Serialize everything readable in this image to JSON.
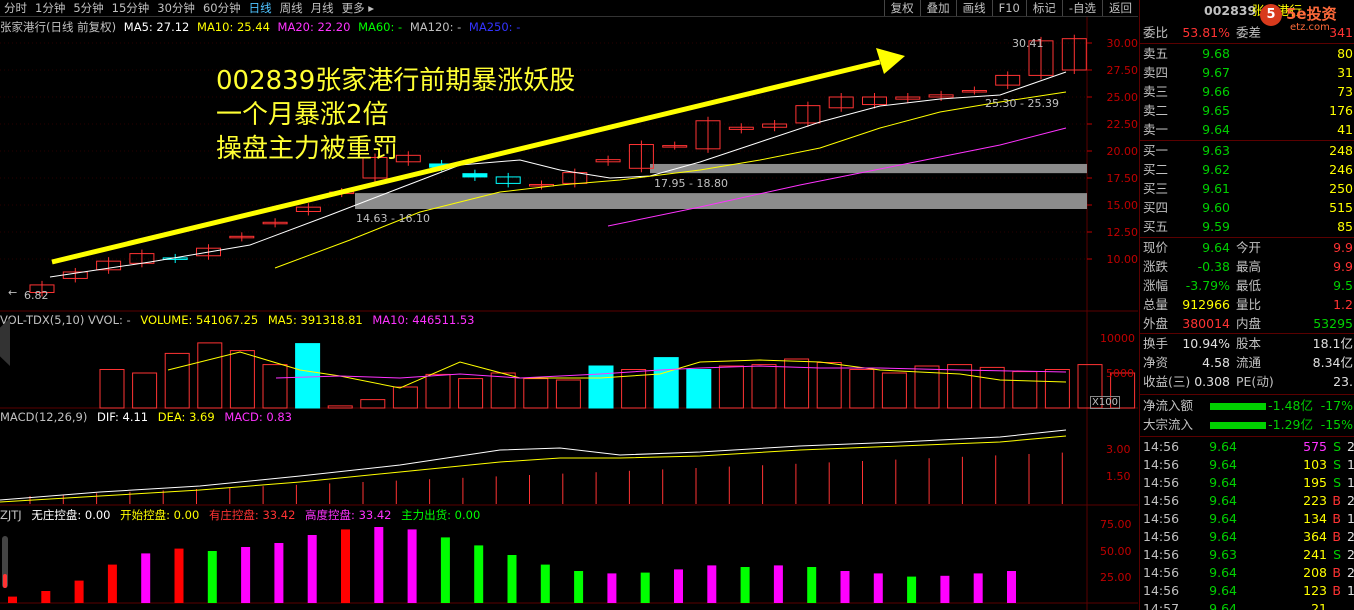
{
  "toolbar": {
    "periods": [
      "分时",
      "1分钟",
      "5分钟",
      "15分钟",
      "30分钟",
      "60分钟",
      "日线",
      "周线",
      "月线",
      "更多 ▸"
    ],
    "active_index": 6,
    "tools": [
      "复权",
      "叠加",
      "画线",
      "F10",
      "标记",
      "-自选",
      "返回"
    ]
  },
  "main_chart": {
    "title": "张家港行(日线 前复权)",
    "ma_labels": [
      {
        "text": "MA5: 27.12",
        "color": "#ffffff"
      },
      {
        "text": "MA10: 25.44",
        "color": "#ffff00"
      },
      {
        "text": "MA20: 22.20",
        "color": "#ff33ff"
      },
      {
        "text": "MA60: -",
        "color": "#00ff00"
      },
      {
        "text": "MA120: -",
        "color": "#c0c0c0"
      },
      {
        "text": "MA250: -",
        "color": "#3333ff"
      }
    ],
    "y_ticks": [
      "30.00",
      "27.50",
      "25.00",
      "22.50",
      "20.00",
      "17.50",
      "15.00",
      "12.50",
      "10.00"
    ],
    "labels": {
      "high": "30.41",
      "low": "6.82",
      "gap1": "14.63 - 16.10",
      "gap2": "17.95 - 18.80",
      "gap3": "25.30 - 25.39"
    },
    "annotation": [
      "002839张家港行前期暴涨妖股",
      "一个月暴涨2倍",
      "操盘主力被重罚"
    ]
  },
  "volume_panel": {
    "title": "VOL-TDX(5,10) VVOL: -",
    "values": [
      {
        "text": "VOLUME: 541067.25",
        "color": "#ffff00"
      },
      {
        "text": "MA5: 391318.81",
        "color": "#ffff00"
      },
      {
        "text": "MA10: 446511.53",
        "color": "#ff33ff"
      }
    ],
    "y_ticks": [
      "10000",
      "5000"
    ],
    "unit": "X100"
  },
  "macd_panel": {
    "title": "MACD(12,26,9)",
    "values": [
      {
        "text": "DIF: 4.11",
        "color": "#ffffff"
      },
      {
        "text": "DEA: 3.69",
        "color": "#ffff00"
      },
      {
        "text": "MACD: 0.83",
        "color": "#ff33ff"
      }
    ],
    "y_ticks": [
      "3.00",
      "1.50"
    ]
  },
  "zjtj_panel": {
    "title": "ZJTJ",
    "values": [
      {
        "text": "无庄控盘: 0.00",
        "color": "#ffffff"
      },
      {
        "text": "开始控盘: 0.00",
        "color": "#ffff00"
      },
      {
        "text": "有庄控盘: 33.42",
        "color": "#ff3333"
      },
      {
        "text": "高度控盘: 33.42",
        "color": "#ff33ff"
      },
      {
        "text": "主力出货: 0.00",
        "color": "#00ff00"
      }
    ],
    "y_ticks": [
      "75.00",
      "50.00",
      "25.00"
    ]
  },
  "quote": {
    "code": "002839",
    "name_partial": "张家港行",
    "webi_ratio_label": "委比",
    "webi_ratio": "53.81%",
    "webi_diff_label": "委差",
    "webi_diff": "341",
    "sells": [
      {
        "label": "卖五",
        "price": "9.68",
        "vol": "80"
      },
      {
        "label": "卖四",
        "price": "9.67",
        "vol": "31"
      },
      {
        "label": "卖三",
        "price": "9.66",
        "vol": "73"
      },
      {
        "label": "卖二",
        "price": "9.65",
        "vol": "176"
      },
      {
        "label": "卖一",
        "price": "9.64",
        "vol": "41"
      }
    ],
    "buys": [
      {
        "label": "买一",
        "price": "9.63",
        "vol": "248"
      },
      {
        "label": "买二",
        "price": "9.62",
        "vol": "246"
      },
      {
        "label": "买三",
        "price": "9.61",
        "vol": "250"
      },
      {
        "label": "买四",
        "price": "9.60",
        "vol": "515"
      },
      {
        "label": "买五",
        "price": "9.59",
        "vol": "85"
      }
    ],
    "stats": [
      {
        "l1": "现价",
        "v1": "9.64",
        "c1": "#00d000",
        "l2": "今开",
        "v2": "9.9",
        "c2": "#ff3333"
      },
      {
        "l1": "涨跌",
        "v1": "-0.38",
        "c1": "#00d000",
        "l2": "最高",
        "v2": "9.9",
        "c2": "#ff3333"
      },
      {
        "l1": "涨幅",
        "v1": "-3.79%",
        "c1": "#00d000",
        "l2": "最低",
        "v2": "9.5",
        "c2": "#00d000"
      },
      {
        "l1": "总量",
        "v1": "912966",
        "c1": "#ffff00",
        "l2": "量比",
        "v2": "1.2",
        "c2": "#ff3333"
      },
      {
        "l1": "外盘",
        "v1": "380014",
        "c1": "#ff3333",
        "l2": "内盘",
        "v2": "53295",
        "c2": "#00d000"
      }
    ],
    "fundamentals": [
      {
        "l1": "换手",
        "v1": "10.94%",
        "l2": "股本",
        "v2": "18.1亿"
      },
      {
        "l1": "净资",
        "v1": "4.58",
        "l2": "流通",
        "v2": "8.34亿"
      },
      {
        "l1": "收益(三)",
        "v1": "0.308",
        "l2": "PE(动)",
        "v2": "23."
      }
    ],
    "flows": [
      {
        "label": "净流入额",
        "value": "-1.48亿",
        "pct": "-17%"
      },
      {
        "label": "大宗流入",
        "value": "-1.29亿",
        "pct": "-15%"
      }
    ],
    "ticks": [
      {
        "time": "14:56",
        "price": "9.64",
        "vol": "575",
        "side": "S",
        "n": "2"
      },
      {
        "time": "14:56",
        "price": "9.64",
        "vol": "103",
        "side": "S",
        "n": "1"
      },
      {
        "time": "14:56",
        "price": "9.64",
        "vol": "195",
        "side": "S",
        "n": "1"
      },
      {
        "time": "14:56",
        "price": "9.64",
        "vol": "223",
        "side": "B",
        "n": "2"
      },
      {
        "time": "14:56",
        "price": "9.64",
        "vol": "134",
        "side": "B",
        "n": "1"
      },
      {
        "time": "14:56",
        "price": "9.64",
        "vol": "364",
        "side": "B",
        "n": "2"
      },
      {
        "time": "14:56",
        "price": "9.63",
        "vol": "241",
        "side": "S",
        "n": "2"
      },
      {
        "time": "14:56",
        "price": "9.64",
        "vol": "208",
        "side": "B",
        "n": "2"
      },
      {
        "time": "14:56",
        "price": "9.64",
        "vol": "123",
        "side": "B",
        "n": "1"
      },
      {
        "time": "14:57",
        "price": "9.64",
        "vol": "21",
        "side": "",
        "n": ""
      }
    ]
  },
  "logo": {
    "text": "5e投资",
    "site": "etz.com"
  },
  "colors": {
    "up": "#ff3333",
    "down": "#00ffff",
    "ma5": "#ffffff",
    "ma10": "#ffff00",
    "ma20": "#ff33ff",
    "grid": "#5a0000"
  }
}
